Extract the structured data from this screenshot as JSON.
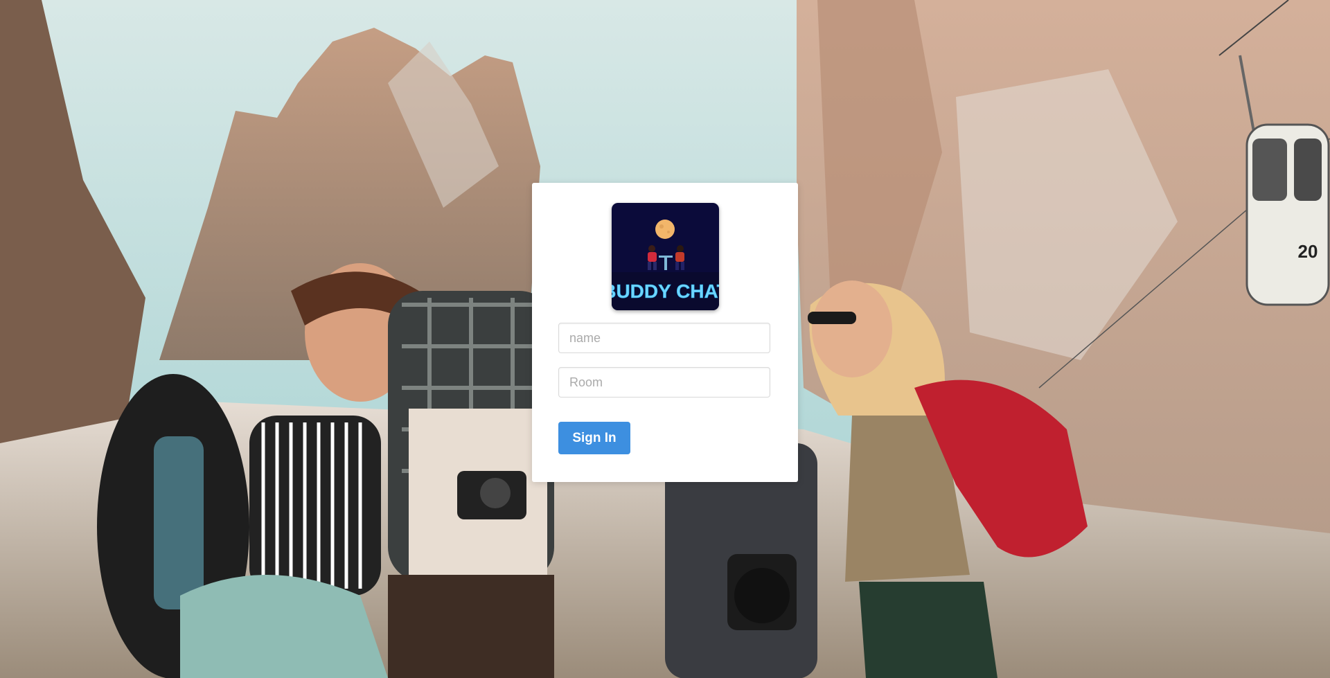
{
  "background": {
    "description_icon": "mountain-hikers-photo"
  },
  "logo": {
    "text": "BUDDY CHAT",
    "icon": "moon-couple-table-icon",
    "colors": {
      "bg": "#0b0b3a",
      "text": "#6fd6ff",
      "moon": "#f2b66a"
    }
  },
  "form": {
    "name_placeholder": "name",
    "name_value": "",
    "room_placeholder": "Room",
    "room_value": "",
    "submit_label": "Sign In"
  },
  "colors": {
    "button": "#3d8fe0",
    "card": "#ffffff"
  }
}
